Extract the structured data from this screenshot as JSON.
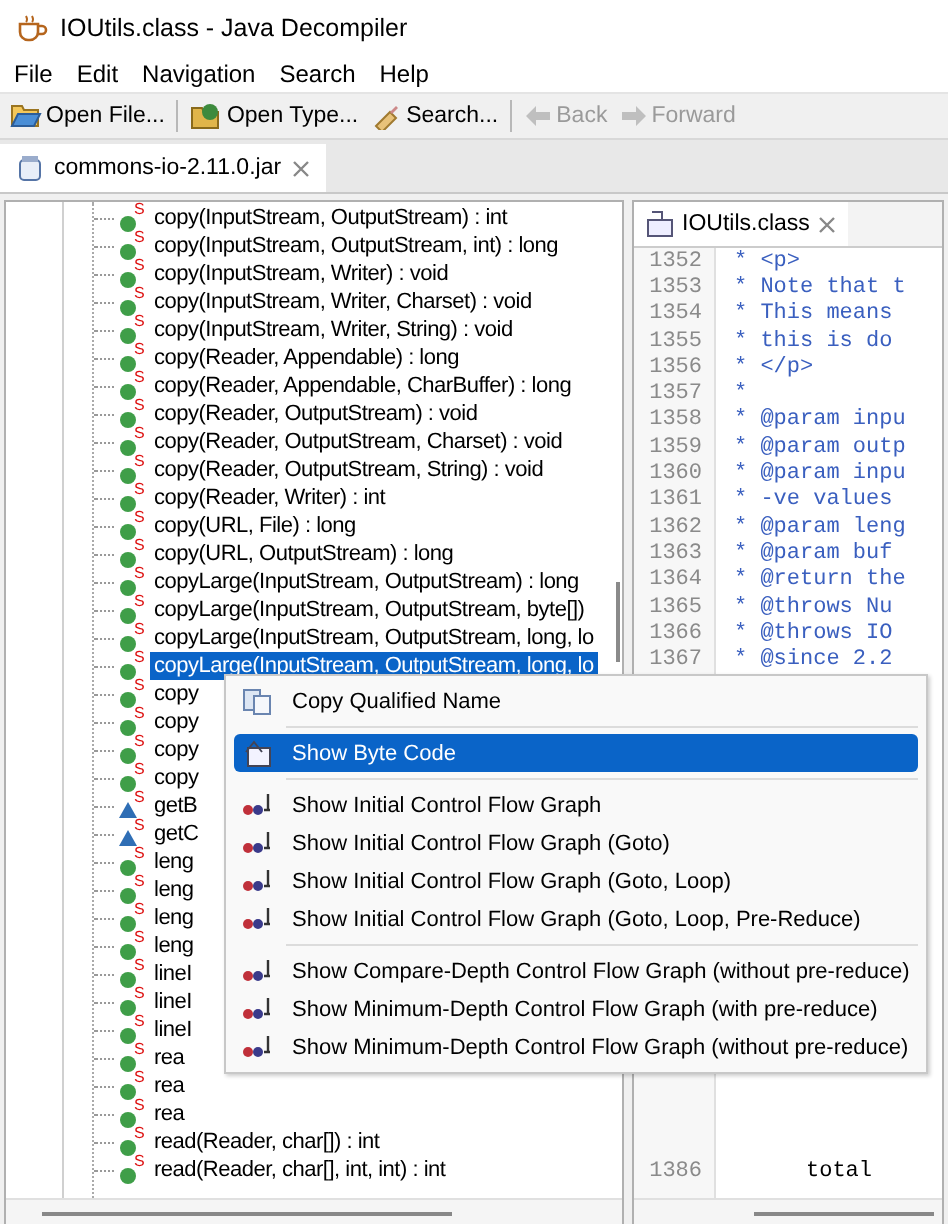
{
  "window": {
    "title": "IOUtils.class - Java Decompiler"
  },
  "menu_bar": [
    "File",
    "Edit",
    "Navigation",
    "Search",
    "Help"
  ],
  "toolbar": [
    {
      "kind": "open-file",
      "label": "Open File...",
      "disabled": false
    },
    {
      "kind": "open-type",
      "label": "Open Type...",
      "disabled": false
    },
    {
      "kind": "search",
      "label": "Search...",
      "disabled": false
    },
    {
      "kind": "back",
      "label": "Back",
      "disabled": true
    },
    {
      "kind": "forward",
      "label": "Forward",
      "disabled": true
    }
  ],
  "tabs": [
    {
      "label": "commons-io-2.11.0.jar",
      "selected": true
    }
  ],
  "tree": {
    "items": [
      {
        "label": "copy(InputStream, OutputStream) : int",
        "kind": "public",
        "badge": "S",
        "selected": false
      },
      {
        "label": "copy(InputStream, OutputStream, int) : long",
        "kind": "public",
        "badge": "S",
        "selected": false
      },
      {
        "label": "copy(InputStream, Writer) : void",
        "kind": "public",
        "badge": "S",
        "selected": false
      },
      {
        "label": "copy(InputStream, Writer, Charset) : void",
        "kind": "public",
        "badge": "S",
        "selected": false
      },
      {
        "label": "copy(InputStream, Writer, String) : void",
        "kind": "public",
        "badge": "S",
        "selected": false
      },
      {
        "label": "copy(Reader, Appendable) : long",
        "kind": "public",
        "badge": "S",
        "selected": false
      },
      {
        "label": "copy(Reader, Appendable, CharBuffer) : long",
        "kind": "public",
        "badge": "S",
        "selected": false
      },
      {
        "label": "copy(Reader, OutputStream) : void",
        "kind": "public",
        "badge": "S",
        "selected": false
      },
      {
        "label": "copy(Reader, OutputStream, Charset) : void",
        "kind": "public",
        "badge": "S",
        "selected": false
      },
      {
        "label": "copy(Reader, OutputStream, String) : void",
        "kind": "public",
        "badge": "S",
        "selected": false
      },
      {
        "label": "copy(Reader, Writer) : int",
        "kind": "public",
        "badge": "S",
        "selected": false
      },
      {
        "label": "copy(URL, File) : long",
        "kind": "public",
        "badge": "S",
        "selected": false
      },
      {
        "label": "copy(URL, OutputStream) : long",
        "kind": "public",
        "badge": "S",
        "selected": false
      },
      {
        "label": "copyLarge(InputStream, OutputStream) : long",
        "kind": "public",
        "badge": "S",
        "selected": false
      },
      {
        "label": "copyLarge(InputStream, OutputStream, byte[])",
        "kind": "public",
        "badge": "S",
        "selected": false
      },
      {
        "label": "copyLarge(InputStream, OutputStream, long, lo",
        "kind": "public",
        "badge": "S",
        "selected": false
      },
      {
        "label": "copyLarge(InputStream, OutputStream, long, lo",
        "kind": "public",
        "badge": "S",
        "selected": true
      },
      {
        "label": "copy",
        "kind": "public",
        "badge": "S",
        "selected": false
      },
      {
        "label": "copy",
        "kind": "public",
        "badge": "S",
        "selected": false
      },
      {
        "label": "copy",
        "kind": "public",
        "badge": "S",
        "selected": false
      },
      {
        "label": "copy",
        "kind": "public",
        "badge": "S",
        "selected": false
      },
      {
        "label": "getB",
        "kind": "package",
        "badge": "S",
        "selected": false
      },
      {
        "label": "getC",
        "kind": "package",
        "badge": "S",
        "selected": false
      },
      {
        "label": "leng",
        "kind": "public",
        "badge": "S",
        "selected": false
      },
      {
        "label": "leng",
        "kind": "public",
        "badge": "S",
        "selected": false
      },
      {
        "label": "leng",
        "kind": "public",
        "badge": "S",
        "selected": false
      },
      {
        "label": "leng",
        "kind": "public",
        "badge": "S",
        "selected": false
      },
      {
        "label": "lineI",
        "kind": "public",
        "badge": "S",
        "selected": false
      },
      {
        "label": "lineI",
        "kind": "public",
        "badge": "S",
        "selected": false
      },
      {
        "label": "lineI",
        "kind": "public",
        "badge": "S",
        "selected": false
      },
      {
        "label": "rea",
        "kind": "public",
        "badge": "S",
        "selected": false
      },
      {
        "label": "rea",
        "kind": "public",
        "badge": "S",
        "selected": false
      },
      {
        "label": "rea",
        "kind": "public",
        "badge": "S",
        "selected": false
      },
      {
        "label": "read(Reader, char[]) : int",
        "kind": "public",
        "badge": "S",
        "selected": false
      },
      {
        "label": "read(Reader, char[], int, int) : int",
        "kind": "public",
        "badge": "S",
        "selected": false
      }
    ]
  },
  "editor": {
    "tab": {
      "label": "IOUtils.class",
      "selected": true
    },
    "lines": [
      {
        "number": "1352",
        "text": "* <p>"
      },
      {
        "number": "1353",
        "text": "* Note that t"
      },
      {
        "number": "1354",
        "text": "* This means"
      },
      {
        "number": "1355",
        "text": "* this is do"
      },
      {
        "number": "1356",
        "text": "* </p>"
      },
      {
        "number": "1357",
        "text": "*"
      },
      {
        "number": "1358",
        "text": "* @param inpu"
      },
      {
        "number": "1359",
        "text": "* @param outp"
      },
      {
        "number": "1360",
        "text": "* @param inpu"
      },
      {
        "number": "1361",
        "text": "* -ve values"
      },
      {
        "number": "1362",
        "text": "* @param leng"
      },
      {
        "number": "1363",
        "text": "* @param buf"
      },
      {
        "number": "1364",
        "text": "* @return the"
      },
      {
        "number": "1365",
        "text": "* @throws Nu"
      },
      {
        "number": "1366",
        "text": "* @throws IO"
      },
      {
        "number": "1367",
        "text": "* @since 2.2"
      }
    ],
    "last_line": {
      "number": "1386",
      "text": "total"
    }
  },
  "context_menu": [
    {
      "kind": "copy",
      "label": "Copy Qualified Name",
      "selected": false
    },
    {
      "kind": "separator"
    },
    {
      "kind": "bytecode",
      "label": "Show Byte Code",
      "selected": true
    },
    {
      "kind": "separator"
    },
    {
      "kind": "graph",
      "label": "Show Initial Control Flow Graph",
      "selected": false
    },
    {
      "kind": "graph",
      "label": "Show Initial Control Flow Graph (Goto)",
      "selected": false
    },
    {
      "kind": "graph",
      "label": "Show Initial Control Flow Graph (Goto, Loop)",
      "selected": false
    },
    {
      "kind": "graph",
      "label": "Show Initial Control Flow Graph (Goto, Loop, Pre-Reduce)",
      "selected": false
    },
    {
      "kind": "separator"
    },
    {
      "kind": "graph",
      "label": "Show Compare-Depth Control Flow Graph (without pre-reduce)",
      "selected": false
    },
    {
      "kind": "graph",
      "label": "Show Minimum-Depth Control Flow Graph (with pre-reduce)",
      "selected": false
    },
    {
      "kind": "graph",
      "label": "Show Minimum-Depth Control Flow Graph (without pre-reduce)",
      "selected": false
    }
  ]
}
